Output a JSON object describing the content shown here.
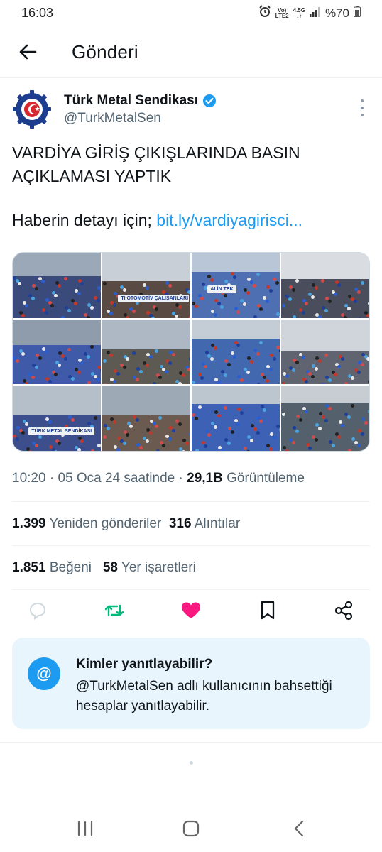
{
  "status_bar": {
    "time": "16:03",
    "network_top": "Vo)",
    "network_bottom": "LTE2",
    "net_type": "4.5G",
    "battery": "%70"
  },
  "header": {
    "title": "Gönderi"
  },
  "tweet": {
    "author_name": "Türk Metal Sendikası",
    "handle": "@TurkMetalSen",
    "text_line1": "VARDİYA GİRİŞ ÇIKIŞLARINDA BASIN",
    "text_line2": "AÇIKLAMASI YAPTIK",
    "link_prefix": "Haberin detayı için; ",
    "link_text": "bit.ly/vardiyagirisci...",
    "photos": [
      {
        "sign": ""
      },
      {
        "sign": "TI OTOMOTİV ÇALIŞANLARI"
      },
      {
        "sign": "ALİN TEK"
      },
      {
        "sign": ""
      },
      {
        "sign": ""
      },
      {
        "sign": ""
      },
      {
        "sign": ""
      },
      {
        "sign": ""
      },
      {
        "sign": "TÜRK METAL SENDİKASI"
      },
      {
        "sign": ""
      },
      {
        "sign": ""
      },
      {
        "sign": ""
      }
    ],
    "time": "10:20",
    "date": "05 Oca 24 saatinde",
    "views_count": "29,1B",
    "views_label": "Görüntüleme",
    "retweets_count": "1.399",
    "retweets_label": "Yeniden gönderiler",
    "quotes_count": "316",
    "quotes_label": "Alıntılar",
    "likes_count": "1.851",
    "likes_label": "Beğeni",
    "bookmarks_count": "58",
    "bookmarks_label": "Yer işaretleri"
  },
  "reply_restriction": {
    "icon": "@",
    "title": "Kimler yanıtlayabilir?",
    "body": "@TurkMetalSen adlı kullanıcının bahsettiği hesaplar yanıtlayabilir."
  },
  "colors": {
    "accent": "#1d9bf0",
    "retweet": "#00ba7c",
    "like": "#f91880",
    "muted": "#536471"
  }
}
